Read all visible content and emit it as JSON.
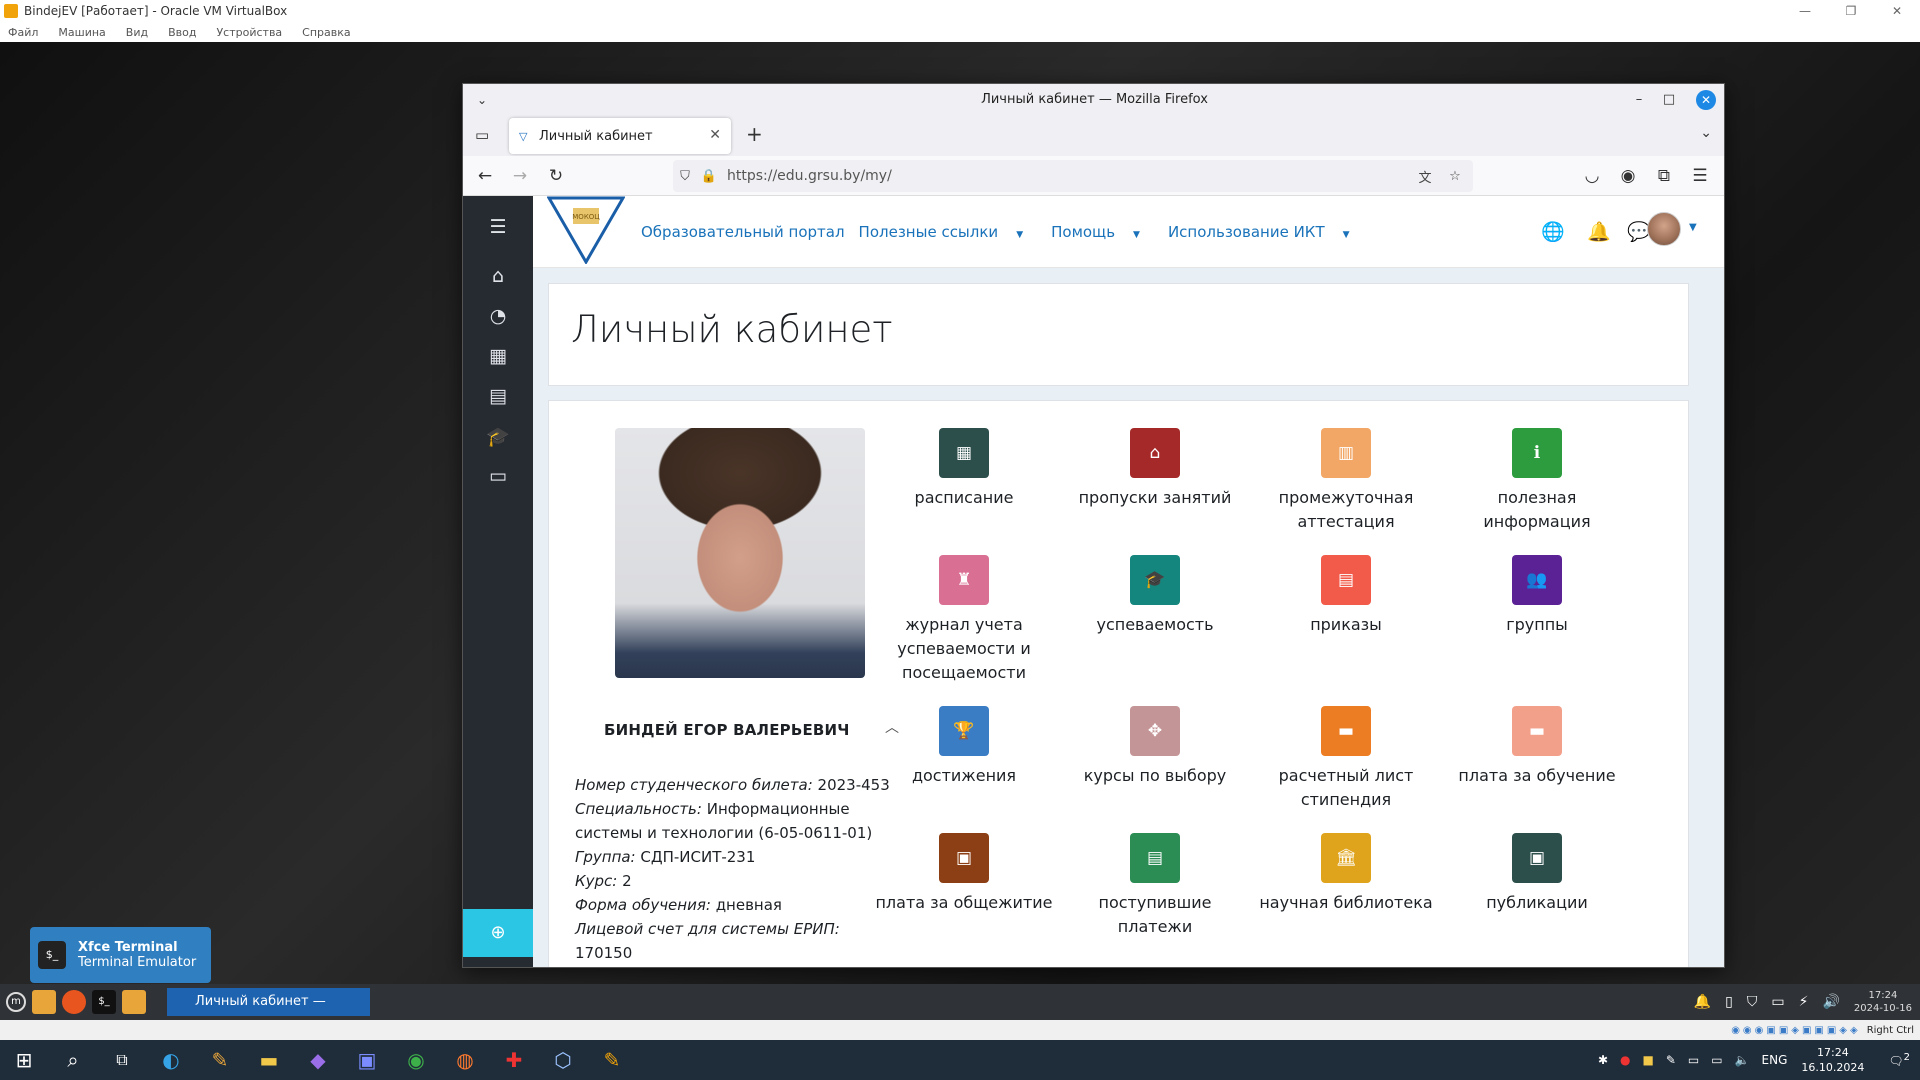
{
  "vbox": {
    "title": "BindejEV [Работает] - Oracle VM VirtualBox",
    "menu": [
      "Файл",
      "Машина",
      "Вид",
      "Ввод",
      "Устройства",
      "Справка"
    ],
    "status_right": "Right Ctrl"
  },
  "firefox": {
    "title": "Личный кабинет — Mozilla Firefox",
    "tab_title": "Личный кабинет",
    "url": "https://edu.grsu.by/my/"
  },
  "site": {
    "logo_text": "МОКОЦ",
    "nav": [
      "Образовательный портал",
      "Полезные ссылки",
      "Помощь",
      "Использование ИКТ"
    ],
    "page_title": "Личный кабинет"
  },
  "student": {
    "name": "БИНДЕЙ ЕГОР ВАЛЕРЬЕВИЧ",
    "fields": [
      {
        "label": "Номер студенческого билета:",
        "value": " 2023-453"
      },
      {
        "label": "Специальность:",
        "value": " Информационные системы и технологии (6-05-0611-01)"
      },
      {
        "label": "Группа:",
        "value": " СДП-ИСИТ-231"
      },
      {
        "label": "Курс:",
        "value": " 2"
      },
      {
        "label": "Форма обучения:",
        "value": " дневная"
      },
      {
        "label": "Лицевой счет для системы ЕРИП:",
        "value": " 170150"
      }
    ]
  },
  "tiles": [
    {
      "label": "расписание",
      "color": "#2d4f4c",
      "icon": "▦"
    },
    {
      "label": "пропуски занятий",
      "color": "#a52929",
      "icon": "⌂"
    },
    {
      "label": "промежуточная аттестация",
      "color": "#f2a766",
      "icon": "▥"
    },
    {
      "label": "полезная информация",
      "color": "#2c9c3e",
      "icon": "ℹ"
    },
    {
      "label": "журнал учета успеваемости и посещаемости",
      "color": "#d96f93",
      "icon": "♜"
    },
    {
      "label": "успеваемость",
      "color": "#14867d",
      "icon": "🎓"
    },
    {
      "label": "приказы",
      "color": "#f25b4a",
      "icon": "▤"
    },
    {
      "label": "группы",
      "color": "#5b2296",
      "icon": "👥"
    },
    {
      "label": "достижения",
      "color": "#3b7dc4",
      "icon": "🏆"
    },
    {
      "label": "курсы по выбору",
      "color": "#c49596",
      "icon": "✥"
    },
    {
      "label": "расчетный лист стипендия",
      "color": "#ec7d22",
      "icon": "▬"
    },
    {
      "label": "плата за обучение",
      "color": "#f3a08b",
      "icon": "▬"
    },
    {
      "label": "плата за общежитие",
      "color": "#8c3f14",
      "icon": "▣"
    },
    {
      "label": "поступившие платежи",
      "color": "#2b8c54",
      "icon": "▤"
    },
    {
      "label": "научная библиотека",
      "color": "#dfa41c",
      "icon": "🏛"
    },
    {
      "label": "публикации",
      "color": "#2d4f4c",
      "icon": "▣"
    }
  ],
  "notification": {
    "title": "Xfce Terminal",
    "subtitle": "Terminal Emulator"
  },
  "guest_taskbar": {
    "task": "Личный кабинет — Mozill...",
    "time": "17:24",
    "date": "2024-10-16"
  },
  "host_taskbar": {
    "lang": "ENG",
    "time": "17:24",
    "date": "16.10.2024",
    "notif_count": "2"
  }
}
